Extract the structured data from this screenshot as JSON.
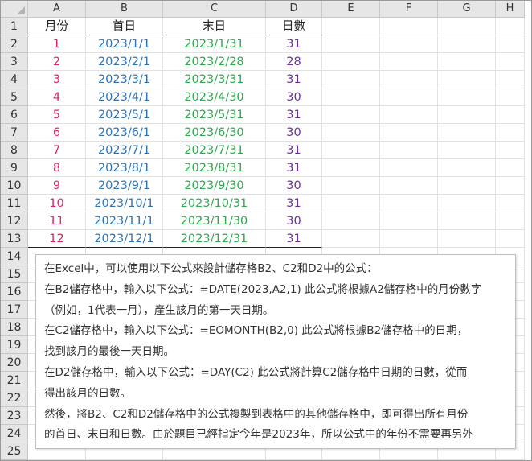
{
  "columns": [
    "A",
    "B",
    "C",
    "D",
    "E",
    "F",
    "G",
    "H"
  ],
  "rows": [
    "1",
    "2",
    "3",
    "4",
    "5",
    "6",
    "7",
    "8",
    "9",
    "10",
    "11",
    "12",
    "13",
    "14",
    "15",
    "16",
    "17",
    "18",
    "19",
    "20",
    "21",
    "22",
    "23",
    "24",
    "25"
  ],
  "table": {
    "headers": [
      "月份",
      "首日",
      "末日",
      "日數"
    ],
    "data": [
      [
        "1",
        "2023/1/1",
        "2023/1/31",
        "31"
      ],
      [
        "2",
        "2023/2/1",
        "2023/2/28",
        "28"
      ],
      [
        "3",
        "2023/3/1",
        "2023/3/31",
        "31"
      ],
      [
        "4",
        "2023/4/1",
        "2023/4/30",
        "30"
      ],
      [
        "5",
        "2023/5/1",
        "2023/5/31",
        "31"
      ],
      [
        "6",
        "2023/6/1",
        "2023/6/30",
        "30"
      ],
      [
        "7",
        "2023/7/1",
        "2023/7/31",
        "31"
      ],
      [
        "8",
        "2023/8/1",
        "2023/8/31",
        "31"
      ],
      [
        "9",
        "2023/9/1",
        "2023/9/30",
        "30"
      ],
      [
        "10",
        "2023/10/1",
        "2023/10/31",
        "31"
      ],
      [
        "11",
        "2023/11/1",
        "2023/11/30",
        "30"
      ],
      [
        "12",
        "2023/12/1",
        "2023/12/31",
        "31"
      ]
    ]
  },
  "textbox": {
    "lines": [
      "在Excel中，可以使用以下公式來設計儲存格B2、C2和D2中的公式：",
      "在B2儲存格中，輸入以下公式：=DATE(2023,A2,1) 此公式將根據A2儲存格中的月份數字",
      "（例如，1代表一月），產生該月的第一天日期。",
      "在C2儲存格中，輸入以下公式：=EOMONTH(B2,0) 此公式將根據B2儲存格中的日期，",
      "找到該月的最後一天日期。",
      "在D2儲存格中，輸入以下公式：=DAY(C2) 此公式將計算C2儲存格中日期的日數，從而",
      "得出該月的日數。",
      "然後，將B2、C2和D2儲存格中的公式複製到表格中的其他儲存格中，即可得出所有月份",
      "的首日、末日和日數。由於題目已經指定今年是2023年，所以公式中的年份不需要再另外"
    ]
  }
}
